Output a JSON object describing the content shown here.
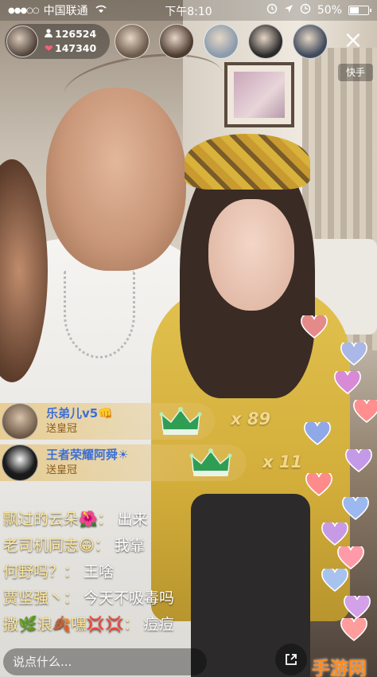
{
  "status_bar": {
    "signal": "●●●○○",
    "carrier": "中国联通",
    "wifi_icon": "wifi-icon",
    "time": "下午8:10",
    "battery_text": "50%",
    "battery_level": 0.5
  },
  "host": {
    "avatar_icon": "host-avatar",
    "viewer_count": "126524",
    "like_count": "147340"
  },
  "viewers": [
    {
      "avatar": "viewer-avatar-1",
      "color": "#6c5a4a"
    },
    {
      "avatar": "viewer-avatar-2",
      "color": "#4d3b30"
    },
    {
      "avatar": "viewer-avatar-3",
      "color": "#8a9bab"
    },
    {
      "avatar": "viewer-avatar-4",
      "color": "#2a2a2a"
    },
    {
      "avatar": "viewer-avatar-5",
      "color": "#3f4a5c"
    }
  ],
  "close_label": "×",
  "watermark": "快手",
  "gifts": [
    {
      "name": "乐弟儿v5👊",
      "action": "送皇冠",
      "count": "x 89"
    },
    {
      "name": "王者荣耀阿舜☀",
      "action": "送皇冠",
      "count": "x 11"
    }
  ],
  "comments": [
    {
      "user": "飘过的云朵🌺：",
      "text": "出来"
    },
    {
      "user": "老司机同志😁：",
      "text": "我靠"
    },
    {
      "user": "何野吗？：",
      "text": "王啥"
    },
    {
      "user": "贾坚强丶：",
      "text": "今天不吸毒吗"
    },
    {
      "user": "撒🌿浪🍂嘿💢💢：",
      "text": "痘痘"
    }
  ],
  "input_placeholder": "说点什么...",
  "share_icon": "share-icon",
  "logo_watermark": "手游网",
  "colors": {
    "username": "#ffe89a",
    "gift_name": "#3d6fd6",
    "gift_count": "#f3d88a"
  }
}
